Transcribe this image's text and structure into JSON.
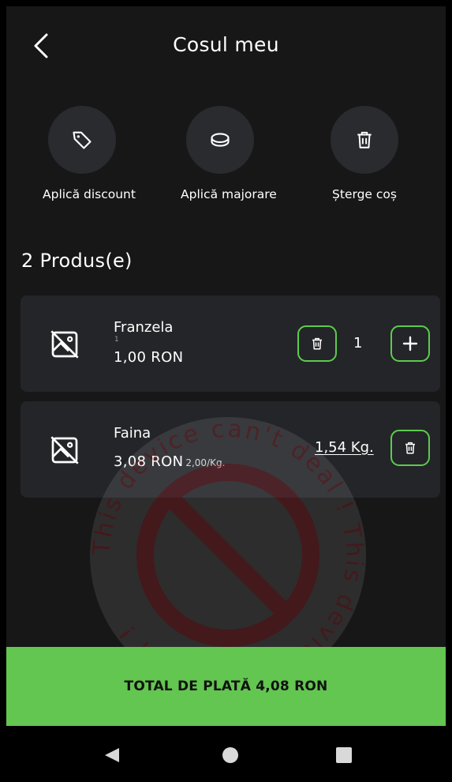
{
  "header": {
    "title": "Cosul meu"
  },
  "actions": [
    {
      "label": "Aplică discount",
      "icon": "tag-icon"
    },
    {
      "label": "Aplică majorare",
      "icon": "coin-icon"
    },
    {
      "label": "Șterge coș",
      "icon": "trash-icon"
    }
  ],
  "cart": {
    "count_label": "2 Produs(e)",
    "items": [
      {
        "name": "Franzela",
        "small_qty": "1",
        "price": "1,00 RON",
        "quantity": "1"
      },
      {
        "name": "Faina",
        "price": "3,08 RON",
        "unit_price": "2,00/Kg.",
        "weight": "1,54 Kg."
      }
    ]
  },
  "watermark": {
    "text": "This device can't deal !"
  },
  "total": {
    "label": "TOTAL DE PLATĂ 4,08 RON"
  },
  "colors": {
    "accent": "#62c650",
    "background": "#171717",
    "card": "#242528"
  }
}
